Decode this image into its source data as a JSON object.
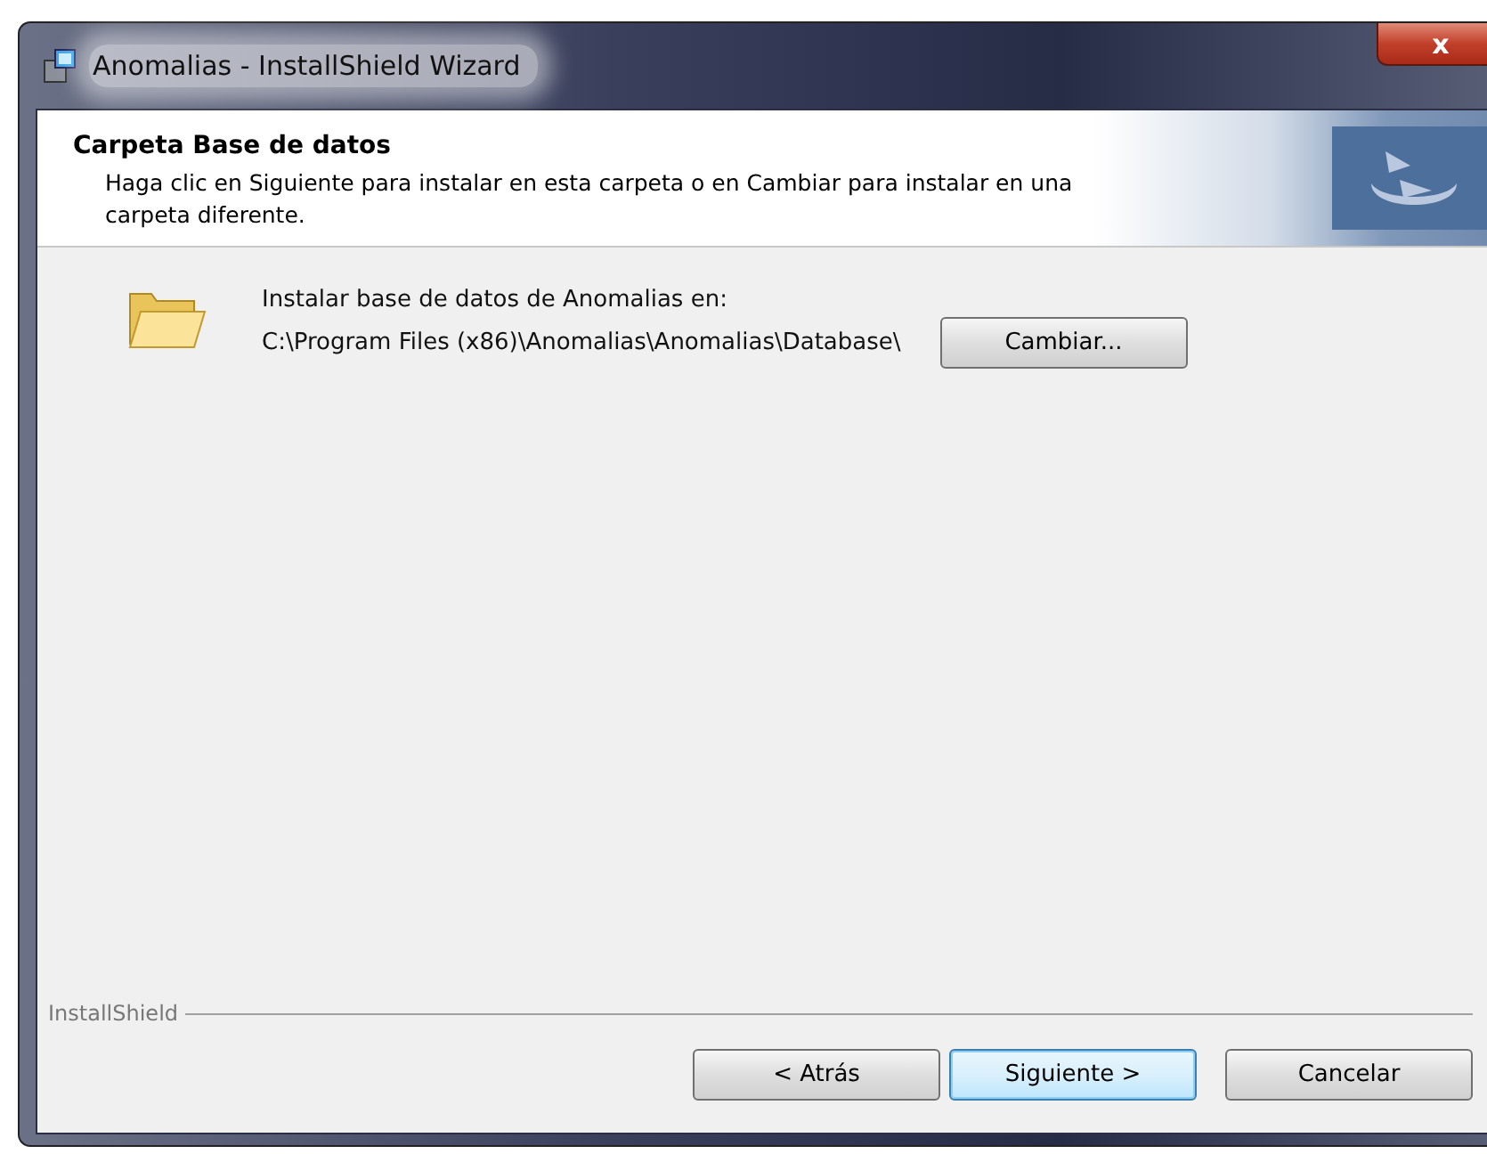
{
  "window": {
    "title": "Anomalias - InstallShield Wizard",
    "close": "x"
  },
  "header": {
    "title": "Carpeta Base de datos",
    "description": "Haga clic en Siguiente para instalar en esta carpeta o en Cambiar para instalar en una carpeta diferente."
  },
  "folder": {
    "label": "Instalar base de datos de Anomalias en:",
    "path": "C:\\Program Files (x86)\\Anomalias\\Anomalias\\Database\\",
    "change_button": "Cambiar..."
  },
  "footer": {
    "brand": "InstallShield"
  },
  "buttons": [
    {
      "label": "< Atrás",
      "default": false
    },
    {
      "label": "Siguiente >",
      "default": true
    },
    {
      "label": "Cancelar",
      "default": false
    }
  ]
}
